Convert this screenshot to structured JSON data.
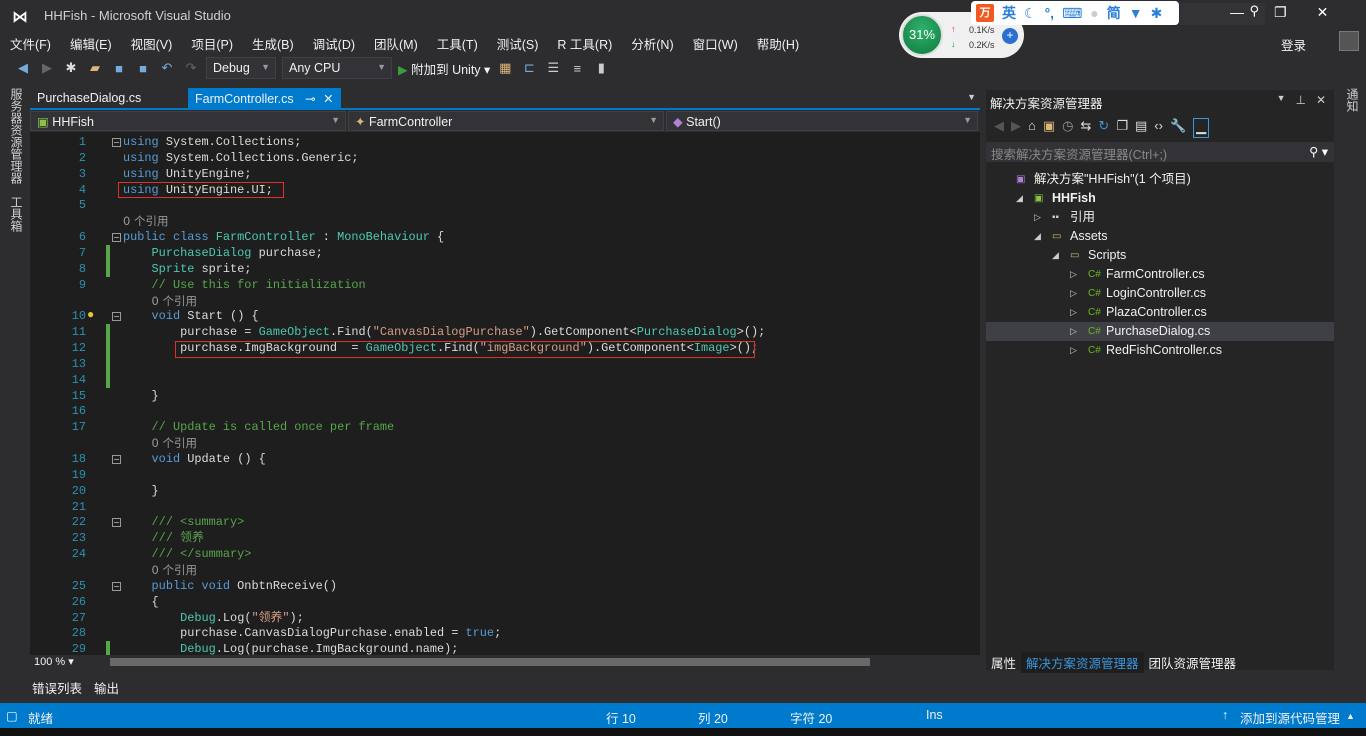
{
  "window": {
    "title": "HHFish - Microsoft Visual Studio",
    "login": "登录"
  },
  "menu": [
    "文件(F)",
    "编辑(E)",
    "视图(V)",
    "项目(P)",
    "生成(B)",
    "调试(D)",
    "团队(M)",
    "工具(T)",
    "测试(S)",
    "R 工具(R)",
    "分析(N)",
    "窗口(W)",
    "帮助(H)"
  ],
  "toolbar": {
    "config": "Debug",
    "platform": "Any CPU",
    "run": "附加到 Unity"
  },
  "overlay": {
    "cpu": "31%",
    "up": "0.1K/s",
    "down": "0.2K/s",
    "ime": [
      "英",
      "简"
    ]
  },
  "left_tabs": [
    "服务器资源管理器",
    "工具箱"
  ],
  "right_tabs": [
    "通知"
  ],
  "doc_tabs": [
    {
      "label": "PurchaseDialog.cs",
      "active": false
    },
    {
      "label": "FarmController.cs",
      "active": true
    }
  ],
  "nav": {
    "project": "HHFish",
    "class": "FarmController",
    "member": "Start()"
  },
  "editor": {
    "zoom": "100 %",
    "rows": [
      {
        "n": "1",
        "fold": "-",
        "t": [
          [
            "using",
            "kw"
          ],
          [
            " System.Collections;",
            "pl"
          ]
        ]
      },
      {
        "n": "2",
        "t": [
          [
            "using",
            "kw"
          ],
          [
            " System.Collections.Generic;",
            "pl"
          ]
        ]
      },
      {
        "n": "3",
        "t": [
          [
            "using",
            "kw"
          ],
          [
            " UnityEngine;",
            "pl"
          ]
        ]
      },
      {
        "n": "4",
        "t": [
          [
            "using",
            "kw"
          ],
          [
            " UnityEngine.UI;",
            "pl"
          ]
        ]
      },
      {
        "n": "5",
        "t": []
      },
      {
        "n": "",
        "t": [
          [
            "0 个引用",
            "lens"
          ]
        ]
      },
      {
        "n": "6",
        "fold": "-",
        "t": [
          [
            "public class ",
            "kw"
          ],
          [
            "FarmController",
            "type"
          ],
          [
            " : ",
            "pl"
          ],
          [
            "MonoBehaviour",
            "type"
          ],
          [
            " {",
            "pl"
          ]
        ]
      },
      {
        "n": "7",
        "chg": true,
        "t": [
          [
            "    ",
            "pl"
          ],
          [
            "PurchaseDialog",
            "type"
          ],
          [
            " purchase;",
            "pl"
          ]
        ]
      },
      {
        "n": "8",
        "chg": true,
        "t": [
          [
            "    ",
            "pl"
          ],
          [
            "Sprite",
            "type"
          ],
          [
            " sprite;",
            "pl"
          ]
        ]
      },
      {
        "n": "9",
        "t": [
          [
            "    // Use this for initialization",
            "cm"
          ]
        ]
      },
      {
        "n": "",
        "t": [
          [
            "    ",
            "pl"
          ],
          [
            "0 个引用",
            "lens"
          ]
        ]
      },
      {
        "n": "10",
        "fold": "-",
        "t": [
          [
            "    void ",
            "kw"
          ],
          [
            "Start",
            "pl"
          ],
          [
            " () {",
            "pl"
          ]
        ]
      },
      {
        "n": "11",
        "chg": true,
        "t": [
          [
            "        purchase = ",
            "pl"
          ],
          [
            "GameObject",
            "type"
          ],
          [
            ".Find(",
            "pl"
          ],
          [
            "\"CanvasDialogPurchase\"",
            "str"
          ],
          [
            ").GetComponent<",
            "pl"
          ],
          [
            "PurchaseDialog",
            "type"
          ],
          [
            ">();",
            "pl"
          ]
        ]
      },
      {
        "n": "12",
        "chg": true,
        "t": [
          [
            "        purchase.ImgBackground  = ",
            "pl"
          ],
          [
            "GameObject",
            "type"
          ],
          [
            ".Find(",
            "pl"
          ],
          [
            "\"imgBackground\"",
            "str"
          ],
          [
            ").GetComponent<",
            "pl"
          ],
          [
            "Image",
            "type"
          ],
          [
            ">();",
            "pl"
          ]
        ]
      },
      {
        "n": "13",
        "chg": true,
        "t": []
      },
      {
        "n": "14",
        "chg": true,
        "t": []
      },
      {
        "n": "15",
        "t": [
          [
            "    }",
            "pl"
          ]
        ]
      },
      {
        "n": "16",
        "t": []
      },
      {
        "n": "17",
        "t": [
          [
            "    // Update is called once per frame",
            "cm"
          ]
        ]
      },
      {
        "n": "",
        "t": [
          [
            "    ",
            "pl"
          ],
          [
            "0 个引用",
            "lens"
          ]
        ]
      },
      {
        "n": "18",
        "fold": "-",
        "t": [
          [
            "    void ",
            "kw"
          ],
          [
            "Update",
            "pl"
          ],
          [
            " () {",
            "pl"
          ]
        ]
      },
      {
        "n": "19",
        "t": []
      },
      {
        "n": "20",
        "t": [
          [
            "    }",
            "pl"
          ]
        ]
      },
      {
        "n": "21",
        "t": []
      },
      {
        "n": "22",
        "fold": "-",
        "t": [
          [
            "    /// <summary>",
            "cm"
          ]
        ]
      },
      {
        "n": "23",
        "t": [
          [
            "    /// 领养",
            "cm"
          ]
        ]
      },
      {
        "n": "24",
        "t": [
          [
            "    /// </summary>",
            "cm"
          ]
        ]
      },
      {
        "n": "",
        "t": [
          [
            "    ",
            "pl"
          ],
          [
            "0 个引用",
            "lens"
          ]
        ]
      },
      {
        "n": "25",
        "fold": "-",
        "t": [
          [
            "    public void ",
            "kw"
          ],
          [
            "OnbtnReceive()",
            "pl"
          ]
        ]
      },
      {
        "n": "26",
        "t": [
          [
            "    {",
            "pl"
          ]
        ]
      },
      {
        "n": "27",
        "t": [
          [
            "        ",
            "pl"
          ],
          [
            "Debug",
            "type"
          ],
          [
            ".Log(",
            "pl"
          ],
          [
            "\"领养\"",
            "str"
          ],
          [
            ");",
            "pl"
          ]
        ]
      },
      {
        "n": "28",
        "t": [
          [
            "        purchase.CanvasDialogPurchase.enabled = ",
            "pl"
          ],
          [
            "true",
            "kw"
          ],
          [
            ";",
            "pl"
          ]
        ]
      },
      {
        "n": "29",
        "chg": true,
        "t": [
          [
            "        ",
            "pl"
          ],
          [
            "Debug",
            "type"
          ],
          [
            ".Log(purchase.ImgBackground.name);",
            "pl"
          ]
        ]
      }
    ]
  },
  "bottom_tabs": [
    "错误列表",
    "输出"
  ],
  "status": {
    "ready": "就绪",
    "line": "行 10",
    "col": "列 20",
    "char": "字符 20",
    "mode": "Ins",
    "source": "添加到源代码管理"
  },
  "solution_explorer": {
    "title": "解决方案资源管理器",
    "search_placeholder": "搜索解决方案资源管理器(Ctrl+;)",
    "tree": [
      {
        "label": "解决方案\"HHFish\"(1 个项目)",
        "depth": 0,
        "exp": "",
        "icon": "solution"
      },
      {
        "label": "HHFish",
        "depth": 1,
        "exp": "◢",
        "icon": "project",
        "bold": true
      },
      {
        "label": "引用",
        "depth": 2,
        "exp": "▷",
        "icon": "references"
      },
      {
        "label": "Assets",
        "depth": 2,
        "exp": "◢",
        "icon": "folder"
      },
      {
        "label": "Scripts",
        "depth": 3,
        "exp": "◢",
        "icon": "folder"
      },
      {
        "label": "FarmController.cs",
        "depth": 4,
        "exp": "▷",
        "icon": "csharp"
      },
      {
        "label": "LoginController.cs",
        "depth": 4,
        "exp": "▷",
        "icon": "csharp"
      },
      {
        "label": "PlazaController.cs",
        "depth": 4,
        "exp": "▷",
        "icon": "csharp"
      },
      {
        "label": "PurchaseDialog.cs",
        "depth": 4,
        "exp": "▷",
        "icon": "csharp",
        "selected": true
      },
      {
        "label": "RedFishController.cs",
        "depth": 4,
        "exp": "▷",
        "icon": "csharp"
      }
    ],
    "tabs": [
      "属性",
      "解决方案资源管理器",
      "团队资源管理器"
    ]
  },
  "colors": {
    "accent": "#007acc",
    "keyword": "#569cd6",
    "type": "#4ec9b0",
    "string": "#d69d85",
    "comment": "#57a64a",
    "highlight_box": "#e0302e"
  }
}
